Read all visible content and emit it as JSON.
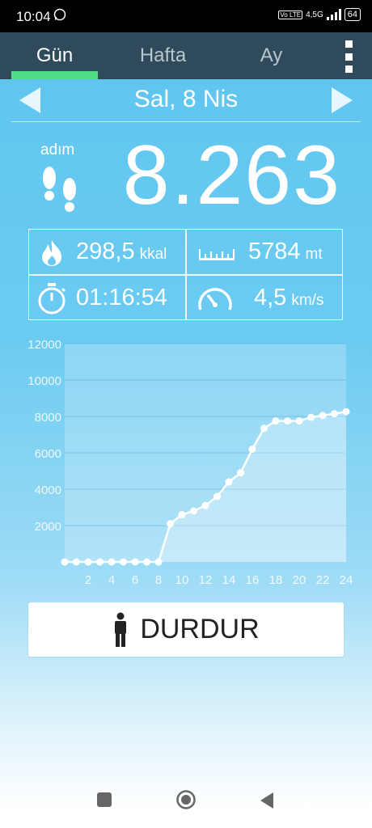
{
  "status": {
    "time": "10:04",
    "network": "4,5G",
    "volte": "Vo LTE",
    "battery": "64"
  },
  "tabs": [
    {
      "label": "Gün",
      "active": true
    },
    {
      "label": "Hafta",
      "active": false
    },
    {
      "label": "Ay",
      "active": false
    }
  ],
  "date": {
    "label": "Sal, 8 Nis"
  },
  "steps": {
    "label": "adım",
    "value": "8.263"
  },
  "stats": {
    "calories": {
      "value": "298,5",
      "unit": "kkal"
    },
    "distance": {
      "value": "5784",
      "unit": "mt"
    },
    "duration": {
      "value": "01:16:54"
    },
    "speed": {
      "value": "4,5",
      "unit": "km/s"
    }
  },
  "chart_data": {
    "type": "area",
    "x": [
      0,
      1,
      2,
      3,
      4,
      5,
      6,
      7,
      8,
      9,
      10,
      11,
      12,
      13,
      14,
      15,
      16,
      17,
      18,
      19,
      20,
      21,
      22,
      23,
      24
    ],
    "y": [
      0,
      0,
      0,
      0,
      0,
      0,
      0,
      0,
      0,
      2100,
      2600,
      2800,
      3100,
      3600,
      4400,
      4900,
      6200,
      7350,
      7750,
      7750,
      7750,
      7950,
      8050,
      8150,
      8263
    ],
    "x_ticks": [
      "2",
      "4",
      "6",
      "8",
      "10",
      "12",
      "14",
      "16",
      "18",
      "20",
      "22",
      "24"
    ],
    "x_tick_values": [
      2,
      4,
      6,
      8,
      10,
      12,
      14,
      16,
      18,
      20,
      22,
      24
    ],
    "y_ticks": [
      "2000",
      "4000",
      "6000",
      "8000",
      "10000",
      "12000"
    ],
    "y_tick_values": [
      2000,
      4000,
      6000,
      8000,
      10000,
      12000
    ],
    "xlim": [
      0,
      24
    ],
    "ylim": [
      0,
      12000
    ],
    "grid": true
  },
  "button": {
    "label": "DURDUR"
  },
  "colors": {
    "tabbar": "#2f4a5a",
    "tab_indicator": "#52dc8a",
    "line": "#ffffff"
  }
}
